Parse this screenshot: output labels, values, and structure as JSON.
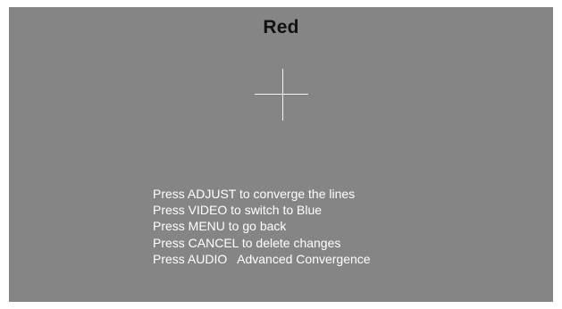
{
  "screen": {
    "title": "Red",
    "crosshair_icon": "crosshair-icon",
    "instructions": [
      "Press ADJUST to converge the lines",
      "Press VIDEO to switch to Blue",
      "Press MENU to go back",
      "Press CANCEL to delete changes",
      "Press AUDIO   Advanced Convergence"
    ]
  },
  "colors": {
    "background": "#858585",
    "title_text": "#111111",
    "instruction_text": "#ffffff",
    "crosshair": "#f2f2f2"
  }
}
